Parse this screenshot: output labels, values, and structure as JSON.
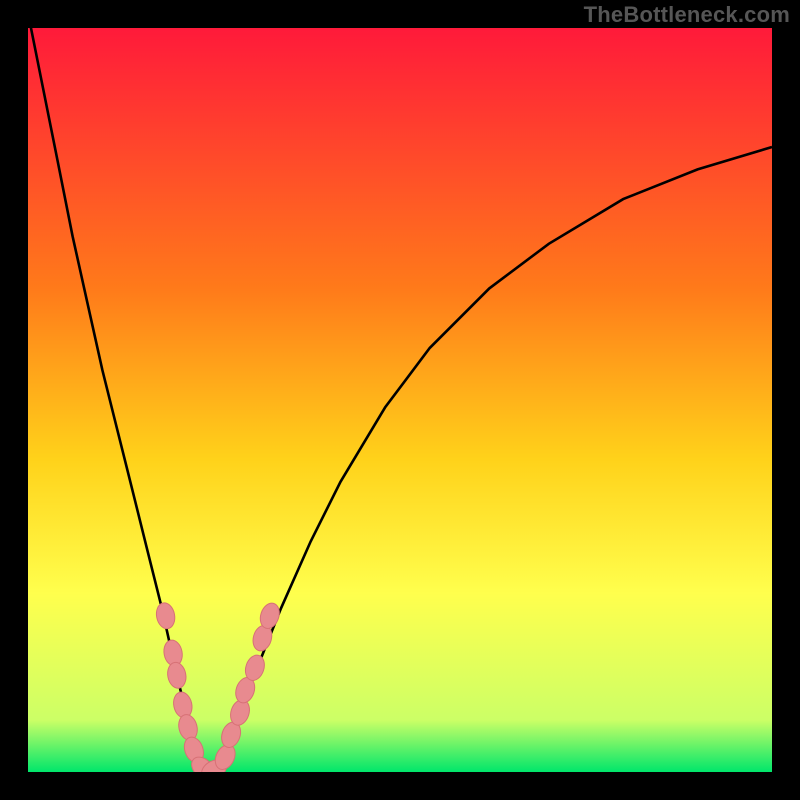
{
  "watermark": "TheBottleneck.com",
  "colors": {
    "bg": "#000000",
    "grad_top": "#ff1a3a",
    "grad_mid1": "#ff7a1a",
    "grad_mid2": "#ffd21a",
    "grad_mid3": "#ffff4d",
    "grad_bot1": "#ccff66",
    "grad_bot2": "#00e66b",
    "curve": "#000000",
    "dot_fill": "#e88a8f",
    "dot_stroke": "#d77176"
  },
  "chart_data": {
    "type": "line",
    "title": "",
    "xlabel": "",
    "ylabel": "",
    "xlim": [
      0,
      100
    ],
    "ylim": [
      0,
      100
    ],
    "series": [
      {
        "name": "bottleneck-curve",
        "x": [
          0,
          2,
          4,
          6,
          8,
          10,
          12,
          14,
          16,
          18,
          20,
          21,
          22,
          23,
          24,
          25,
          26,
          28,
          30,
          34,
          38,
          42,
          48,
          54,
          62,
          70,
          80,
          90,
          100
        ],
        "y": [
          102,
          92,
          82,
          72,
          63,
          54,
          46,
          38,
          30,
          22,
          13,
          9,
          5,
          2,
          0,
          0,
          2,
          6,
          12,
          22,
          31,
          39,
          49,
          57,
          65,
          71,
          77,
          81,
          84
        ]
      }
    ],
    "markers": {
      "name": "highlight-dots",
      "points": [
        {
          "x": 18.5,
          "y": 21
        },
        {
          "x": 19.5,
          "y": 16
        },
        {
          "x": 20.0,
          "y": 13
        },
        {
          "x": 20.8,
          "y": 9
        },
        {
          "x": 21.5,
          "y": 6
        },
        {
          "x": 22.3,
          "y": 3
        },
        {
          "x": 23.5,
          "y": 0.5
        },
        {
          "x": 25.0,
          "y": 0.3
        },
        {
          "x": 26.5,
          "y": 2
        },
        {
          "x": 27.3,
          "y": 5
        },
        {
          "x": 28.5,
          "y": 8
        },
        {
          "x": 29.2,
          "y": 11
        },
        {
          "x": 30.5,
          "y": 14
        },
        {
          "x": 31.5,
          "y": 18
        },
        {
          "x": 32.5,
          "y": 21
        }
      ]
    },
    "gradient_stops": [
      {
        "offset": 0,
        "key": "grad_top"
      },
      {
        "offset": 35,
        "key": "grad_mid1"
      },
      {
        "offset": 58,
        "key": "grad_mid2"
      },
      {
        "offset": 76,
        "key": "grad_mid3"
      },
      {
        "offset": 93,
        "key": "grad_bot1"
      },
      {
        "offset": 100,
        "key": "grad_bot2"
      }
    ]
  }
}
